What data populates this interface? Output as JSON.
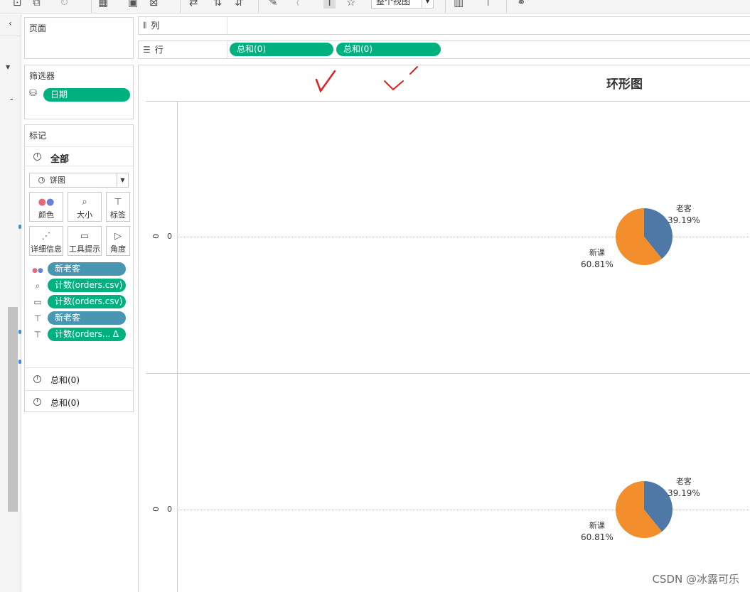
{
  "toolbar": {
    "view_dropdown_label": "整个视图",
    "icons": [
      "add-sheet-icon",
      "duplicate-icon",
      "redo-icon",
      "new-worksheet-icon",
      "save-icon",
      "clear-sheet-icon",
      "swap-icon",
      "sort-asc-icon",
      "sort-desc-icon",
      "highlight-icon",
      "paperclip-icon",
      "label-toggle-icon",
      "pin-icon",
      "show-me-icon",
      "presentation-icon",
      "share-icon"
    ]
  },
  "pages_panel": {
    "title": "页面"
  },
  "filters_panel": {
    "title": "筛选器",
    "filters": [
      {
        "label": "日期",
        "icon": "database-icon"
      }
    ]
  },
  "marks_panel": {
    "title": "标记",
    "all_label": "全部",
    "mark_type": "饼图",
    "buttons": [
      {
        "label": "颜色",
        "icon": "color-dots-icon"
      },
      {
        "label": "大小",
        "icon": "size-icon"
      },
      {
        "label": "标签",
        "icon": "label-icon"
      },
      {
        "label": "详细信息",
        "icon": "detail-icon"
      },
      {
        "label": "工具提示",
        "icon": "tooltip-icon"
      },
      {
        "label": "角度",
        "icon": "angle-icon"
      }
    ],
    "fields": [
      {
        "label": "新老客",
        "icon": "color-dots-icon",
        "color": "#4996b2"
      },
      {
        "label": "计数(orders.csv)",
        "icon": "size-icon",
        "color": "#00b180"
      },
      {
        "label": "计数(orders.csv)",
        "icon": "tooltip-icon",
        "color": "#00b180"
      },
      {
        "label": "新老客",
        "icon": "label-icon",
        "color": "#4996b2"
      },
      {
        "label": "计数(orders...",
        "icon": "label-icon",
        "color": "#00b180",
        "delta": "Δ"
      }
    ],
    "sum_cards": [
      "总和(0)",
      "总和(0)"
    ]
  },
  "shelves": {
    "columns": {
      "label": "列",
      "icon": "columns-icon"
    },
    "rows": {
      "label": "行",
      "icon": "rows-icon",
      "pills": [
        "总和(0)",
        "总和(0)"
      ]
    }
  },
  "canvas": {
    "title": "环形图",
    "axis_ticks": [
      "0",
      "0",
      "0",
      "0"
    ],
    "annotation_marks": [
      "checkmark-annotation-1",
      "checkmark-annotation-2"
    ],
    "pies": [
      {
        "slices": [
          {
            "label": "老客",
            "value": "39.19%",
            "fraction": 0.3919,
            "color": "#4e79a7"
          },
          {
            "label": "新课",
            "value": "60.81%",
            "fraction": 0.6081,
            "color": "#f28e2b"
          }
        ]
      },
      {
        "slices": [
          {
            "label": "老客",
            "value": "39.19%",
            "fraction": 0.3919,
            "color": "#4e79a7"
          },
          {
            "label": "新课",
            "value": "60.81%",
            "fraction": 0.6081,
            "color": "#f28e2b"
          }
        ]
      }
    ]
  },
  "watermark": "CSDN @冰露可乐"
}
